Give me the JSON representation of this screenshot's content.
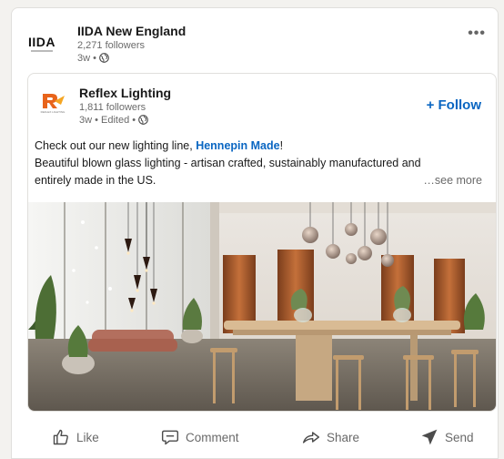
{
  "outer_post": {
    "logo_text": "IIDA",
    "author": "IIDA New England",
    "followers": "2,271 followers",
    "time": "3w •",
    "more": "•••"
  },
  "inner_post": {
    "logo_text": "REFLEX LIGHTING",
    "author": "Reflex Lighting",
    "followers": "1,811 followers",
    "time": "3w • Edited •",
    "follow_label": "+ Follow",
    "text_line1_prefix": "Check out our new lighting line, ",
    "text_line1_link": "Hennepin Made",
    "text_line1_suffix": "!",
    "text_line2": "Beautiful blown glass lighting - artisan crafted, sustainably manufactured and",
    "text_line3": "entirely made in the US.",
    "see_more": "…see more"
  },
  "actions": [
    {
      "label": "Like",
      "icon": "thumbs-up-icon"
    },
    {
      "label": "Comment",
      "icon": "comment-bubble-icon"
    },
    {
      "label": "Share",
      "icon": "share-arrow-icon"
    },
    {
      "label": "Send",
      "icon": "send-plane-icon"
    }
  ],
  "colors": {
    "link_blue": "#0a66c2",
    "reflex_orange": "#e8641b",
    "background": "#f3f2ef"
  }
}
